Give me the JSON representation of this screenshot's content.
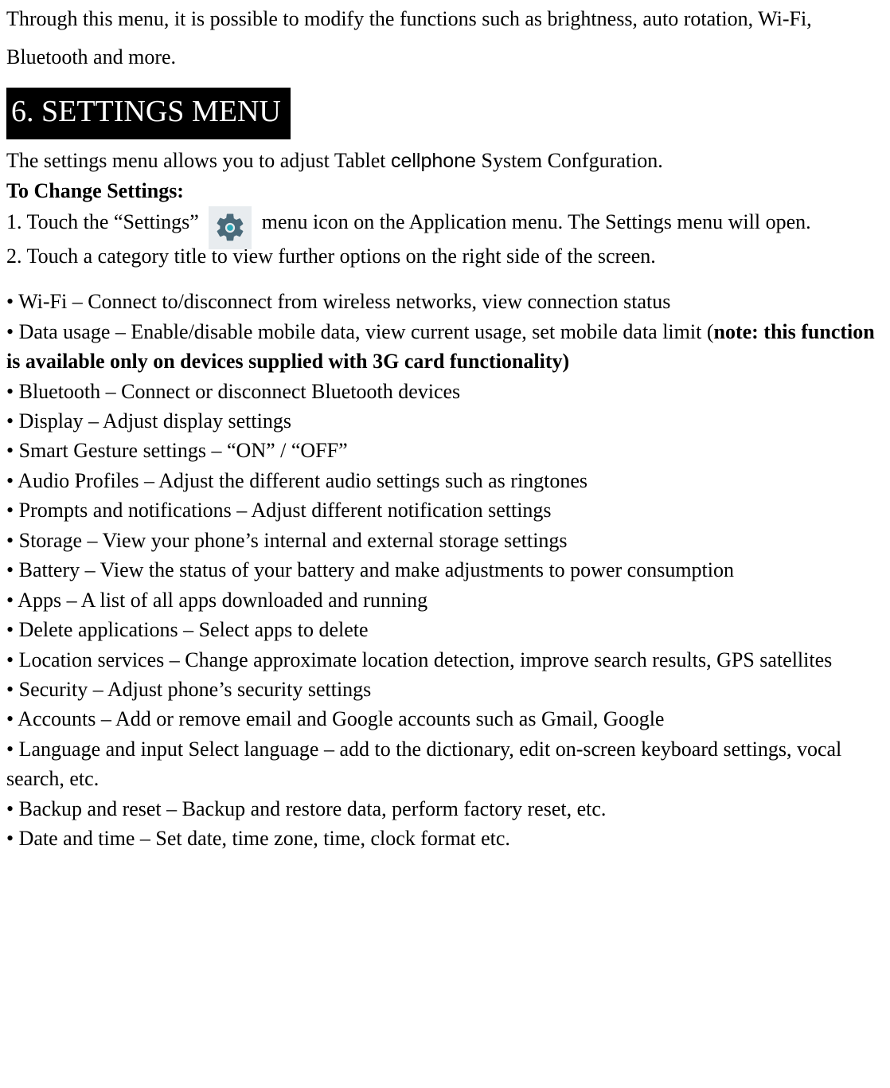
{
  "intro": "Through this menu, it is possible to modify the functions such as brightness, auto rotation, Wi-Fi, Bluetooth and more.",
  "heading": "6. SETTINGS MENU",
  "line_settings_menu_1": "The settings menu allows you to adjust Tablet ",
  "line_settings_menu_cellphone": "cellphone",
  "line_settings_menu_2": " System Confguration.",
  "to_change": "To Change Settings:",
  "step1_a": "1. Touch the “Settings” ",
  "step1_b": " menu icon on the Application menu. The Settings menu will open.",
  "step2": "2. Touch a category title to view further options on the right side of the screen.",
  "bullets": {
    "wifi": "• Wi-Fi – Connect to/disconnect from wireless networks, view connection status",
    "data_usage_a": "• Data usage – Enable/disable mobile data, view current usage, set mobile data limit (",
    "data_usage_note": "note: this function is available only on devices supplied with 3G card functionality)",
    "bluetooth": "• Bluetooth – Connect or disconnect Bluetooth devices",
    "display": "• Display – Adjust display settings",
    "smart_gesture": "• Smart Gesture settings – “ON” / “OFF”",
    "audio": "• Audio Profiles – Adjust the different audio settings such as ringtones",
    "prompts": "• Prompts and notifications – Adjust different notification settings",
    "storage": "• Storage – View your phone’s internal and external storage settings",
    "battery": "• Battery – View the status of your battery and make adjustments to power consumption",
    "apps": "• Apps – A list of all apps downloaded and running",
    "delete_apps": "• Delete applications – Select apps to delete",
    "location": "• Location services – Change approximate location detection, improve search results, GPS satellites",
    "security": "• Security – Adjust phone’s security settings",
    "accounts": "• Accounts – Add or remove email and Google accounts such as Gmail, Google",
    "language": "• Language and input Select language – add to the dictionary, edit on-screen keyboard settings, vocal search, etc.",
    "backup": "• Backup and reset – Backup and restore data, perform factory reset, etc.",
    "datetime": "• Date and time – Set date, time zone, time, clock format etc."
  }
}
